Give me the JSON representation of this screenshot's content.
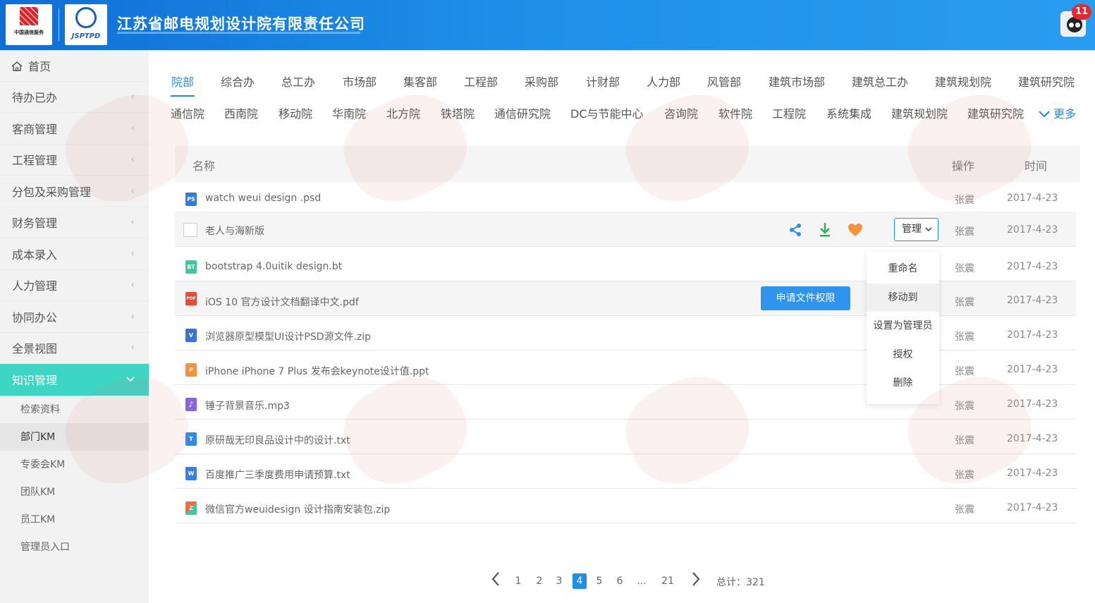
{
  "header": {
    "company_name": "江苏省邮电规划设计院有限责任公司",
    "logo1_text": "中国通信服务",
    "logo2_text": "JSPTPD",
    "notification_count": "11"
  },
  "sidebar": {
    "items": [
      {
        "label": "首页"
      },
      {
        "label": "待办已办"
      },
      {
        "label": "客商管理"
      },
      {
        "label": "工程管理"
      },
      {
        "label": "分包及采购管理"
      },
      {
        "label": "财务管理"
      },
      {
        "label": "成本录入"
      },
      {
        "label": "人力管理"
      },
      {
        "label": "协同办公"
      },
      {
        "label": "全景视图"
      },
      {
        "label": "知识管理"
      }
    ],
    "sub_items": [
      {
        "label": "检索资料"
      },
      {
        "label": "部门KM"
      },
      {
        "label": "专委会KM"
      },
      {
        "label": "团队KM"
      },
      {
        "label": "员工KM"
      },
      {
        "label": "管理员入口"
      }
    ]
  },
  "tabs": {
    "row1": [
      "院部",
      "综合办",
      "总工办",
      "市场部",
      "集客部",
      "工程部",
      "采购部",
      "计财部",
      "人力部",
      "风管部",
      "建筑市场部",
      "建筑总工办",
      "建筑规划院",
      "建筑研究院"
    ],
    "row2": [
      "通信院",
      "西南院",
      "移动院",
      "华南院",
      "北方院",
      "铁塔院",
      "通信研究院",
      "DC与节能中心",
      "咨询院",
      "软件院",
      "工程院",
      "系统集成",
      "建筑规划院",
      "建筑研究院"
    ],
    "more_label": "更多"
  },
  "table": {
    "headers": {
      "name": "名称",
      "action": "操作",
      "time": "时间"
    },
    "rows": [
      {
        "name": "watch weui design .psd",
        "owner": "张震",
        "date": "2017-4-23",
        "icon": "PS",
        "color": "#2f7de1"
      },
      {
        "name": "老人与海新版",
        "owner": "张震",
        "date": "2017-4-23",
        "icon": "",
        "color": ""
      },
      {
        "name": "bootstrap 4.0uitik design.bt",
        "owner": "张震",
        "date": "2017-4-23",
        "icon": "BT",
        "color": "#3cc9a0"
      },
      {
        "name": "iOS 10 官方设计文档翻译中文.pdf",
        "owner": "张震",
        "date": "2017-4-23",
        "icon": "PDF",
        "color": "#e84a3a"
      },
      {
        "name": "浏览器原型模型UI设计PSD源文件.zip",
        "owner": "张震",
        "date": "2017-4-23",
        "icon": "V",
        "color": "#3772d9"
      },
      {
        "name": "iPhone iPhone 7 Plus 发布会keynote设计值.ppt",
        "owner": "张震",
        "date": "2017-4-23",
        "icon": "P",
        "color": "#f5923e"
      },
      {
        "name": "锤子背景音乐.mp3",
        "owner": "张震",
        "date": "2017-4-23",
        "icon": "♪",
        "color": "#8a63e0"
      },
      {
        "name": "原研哉无印良品设计中的设计.txt",
        "owner": "张震",
        "date": "2017-4-23",
        "icon": "T",
        "color": "#2f8de8"
      },
      {
        "name": "百度推广三季度费用申请预算.txt",
        "owner": "张震",
        "date": "2017-4-23",
        "icon": "W",
        "color": "#3a7fe0"
      },
      {
        "name": "微信官方weuidesign 设计指南安装包.zip",
        "owner": "张震",
        "date": "2017-4-23",
        "icon": "Z",
        "color": "#f06a3a"
      }
    ],
    "manage_label": "管理",
    "apply_label": "申请文件权限"
  },
  "dropdown": {
    "items": [
      "重命名",
      "移动到",
      "设置为管理员",
      "授权",
      "删除"
    ]
  },
  "pagination": {
    "pages": [
      "1",
      "2",
      "3",
      "4",
      "5",
      "6",
      "...",
      "21"
    ],
    "current": "4",
    "total_label": "总计：321"
  },
  "colors": {
    "header": "#1e8ee8",
    "accent": "#1e8ee8",
    "sidebar_active": "#3dd6c5",
    "download": "#2bb34a",
    "heart": "#f5923e"
  }
}
